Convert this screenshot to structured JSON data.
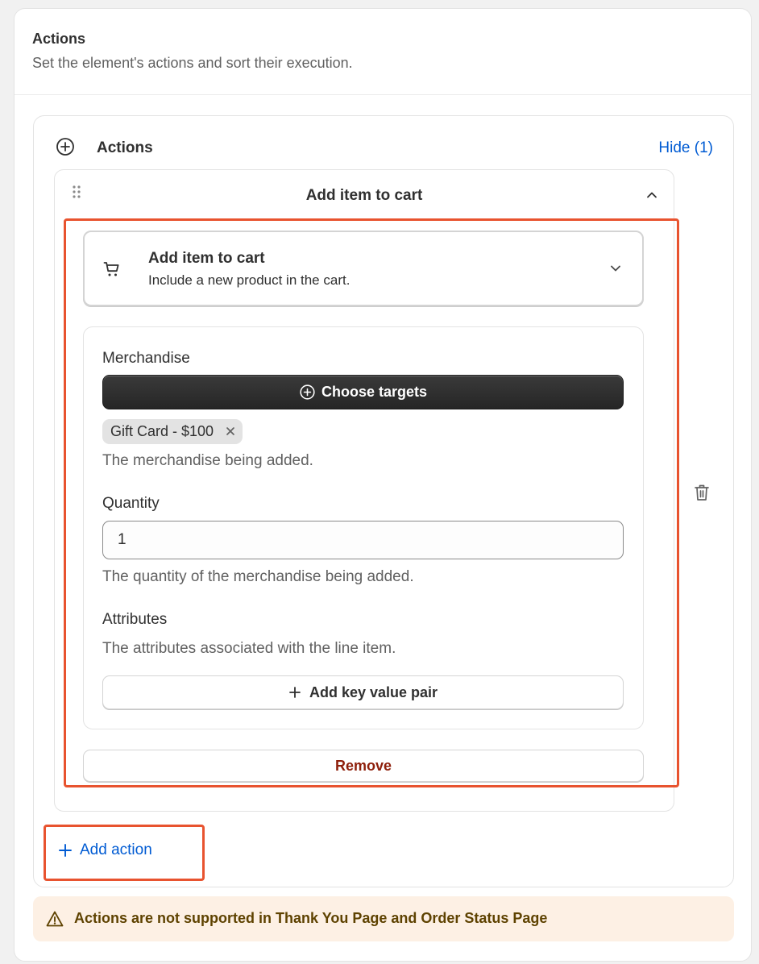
{
  "card": {
    "title": "Actions",
    "subtitle": "Set the element's actions and sort their execution."
  },
  "actions_section": {
    "title": "Actions",
    "hide_link": "Hide (1)",
    "add_action_label": "Add action"
  },
  "action_item": {
    "header_title": "Add item to cart",
    "selector": {
      "title": "Add item to cart",
      "description": "Include a new product in the cart.",
      "icon": "cart-icon"
    },
    "merchandise": {
      "label": "Merchandise",
      "button_label": "Choose targets",
      "tag": "Gift Card - $100",
      "help": "The merchandise being added."
    },
    "quantity": {
      "label": "Quantity",
      "value": "1",
      "help": "The quantity of the merchandise being added."
    },
    "attributes": {
      "label": "Attributes",
      "help": "The attributes associated with the line item.",
      "button_label": "Add key value pair"
    },
    "remove_label": "Remove"
  },
  "warning": {
    "text": "Actions are not supported in Thank You Page and Order Status Page",
    "icon": "warning-icon"
  },
  "colors": {
    "link": "#005bd3",
    "highlight": "#e8532f",
    "critical": "#8e1f0b",
    "warning_bg": "#fdf0e4",
    "warning_text": "#5e4200"
  }
}
